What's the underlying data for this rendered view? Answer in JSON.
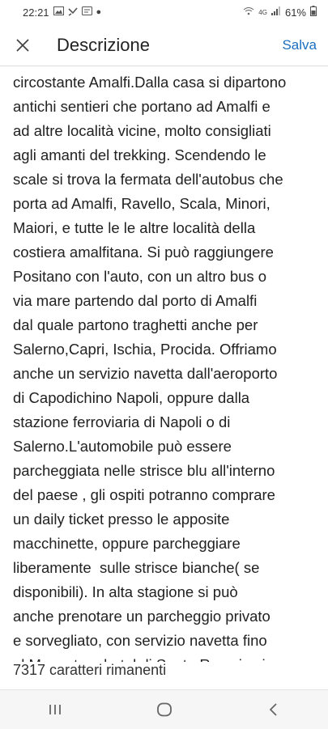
{
  "status_bar": {
    "time": "22:21",
    "network": "4G",
    "battery": "61%",
    "icons": [
      "image-icon",
      "missed-call-icon",
      "message-icon",
      "dot-icon",
      "wifi-icon",
      "signal-icon",
      "battery-icon"
    ]
  },
  "app_bar": {
    "title": "Descrizione",
    "save_label": "Salva",
    "close_icon": "close-icon",
    "accent": "#1a6fbf"
  },
  "editor": {
    "lines": [
      "circostante Amalfi.Dalla casa si dipartono",
      "antichi sentieri che portano ad Amalfi e",
      "ad altre località vicine, molto consigliati",
      "agli amanti del trekking. Scendendo le",
      "scale si trova la fermata dell'autobus che",
      "porta ad Amalfi, Ravello, Scala, Minori,",
      "Maiori, e tutte le le altre località della",
      "costiera amalfitana. Si può raggiungere",
      "Positano con l'auto, con un altro bus o",
      "via mare partendo dal porto di Amalfi",
      "dal quale partono traghetti anche per",
      "Salerno,Capri, Ischia, Procida. Offriamo",
      "anche un servizio navetta dall'aeroporto",
      "di Capodichino Napoli, oppure dalla",
      "stazione ferroviaria di Napoli o di",
      "Salerno.L'automobile può essere",
      "parcheggiata nelle strisce blu all'interno",
      "del paese , gli ospiti potranno comprare",
      "un daily ticket presso le apposite",
      "macchinette, oppure parcheggiare",
      "liberamente  sulle strisce bianche( se",
      "disponibili). In alta stagione si può",
      "anche prenotare un parcheggio privato",
      "e sorvegliato, con servizio navetta fino",
      "al Monastero hotel di Santa Rosa in via"
    ]
  },
  "char_counter": "7317 caratteri rimanenti",
  "nav_bar": {
    "icons": [
      "recent-apps-icon",
      "home-icon",
      "back-icon"
    ]
  }
}
